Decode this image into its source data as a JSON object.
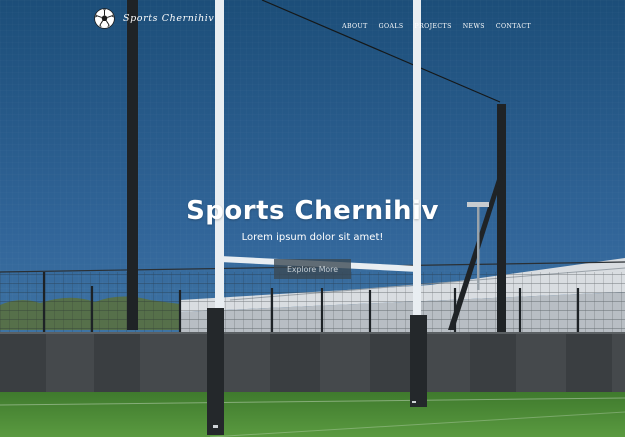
{
  "brand": {
    "name": "Sports Chernihiv",
    "logo_icon": "soccer-ball-icon"
  },
  "nav": {
    "items": [
      {
        "label": "ABOUT"
      },
      {
        "label": "GOALS"
      },
      {
        "label": "PROJECTS"
      },
      {
        "label": "NEWS"
      },
      {
        "label": "CONTACT"
      }
    ]
  },
  "hero": {
    "title": "Sports Chernihiv",
    "subtitle": "Lorem ipsum dolor sit amet!",
    "button_label": "Explore More"
  },
  "colors": {
    "sky_top": "#1c4e79",
    "sky_bottom": "#4b7fa9",
    "grass": "#4a8a34",
    "text": "#ffffff",
    "button_bg": "#3a4852"
  }
}
